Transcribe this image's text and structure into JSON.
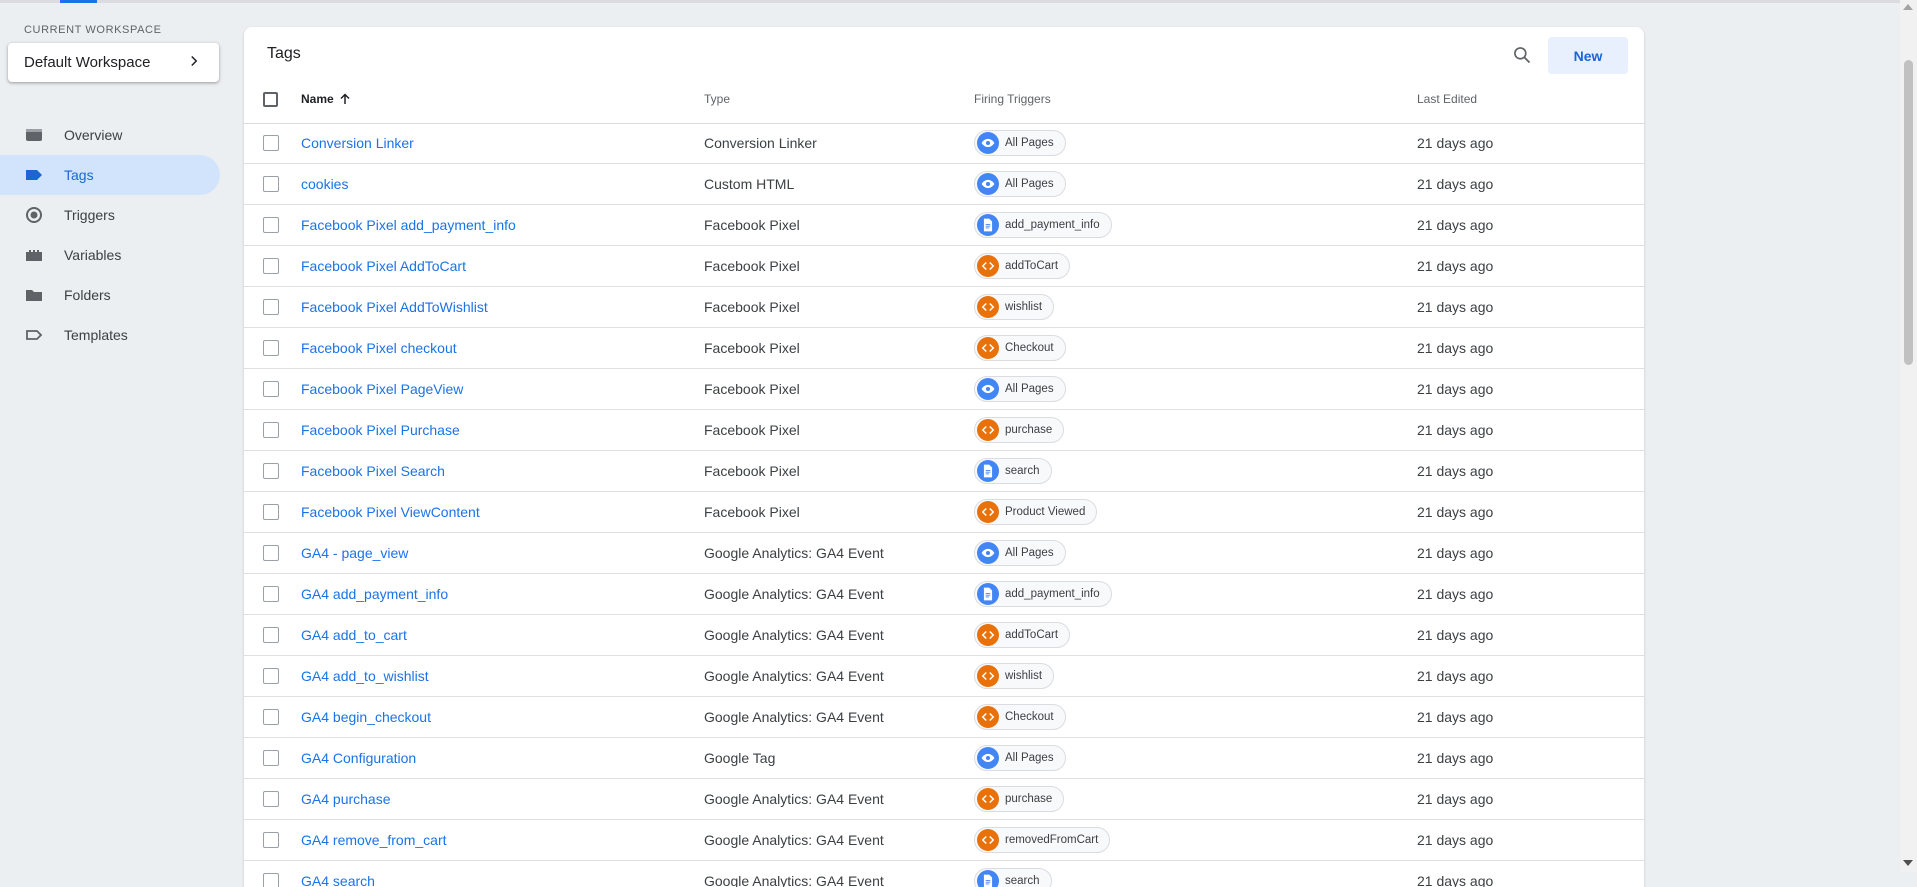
{
  "workspace": {
    "label": "CURRENT WORKSPACE",
    "name": "Default Workspace"
  },
  "nav": [
    {
      "label": "Overview",
      "icon": "overview-icon"
    },
    {
      "label": "Tags",
      "icon": "tag-icon",
      "active": true
    },
    {
      "label": "Triggers",
      "icon": "trigger-icon"
    },
    {
      "label": "Variables",
      "icon": "variables-icon"
    },
    {
      "label": "Folders",
      "icon": "folder-icon"
    },
    {
      "label": "Templates",
      "icon": "template-icon"
    }
  ],
  "card": {
    "title": "Tags",
    "new_label": "New"
  },
  "columns": {
    "name": "Name",
    "type": "Type",
    "triggers": "Firing Triggers",
    "edited": "Last Edited",
    "sort": "ascending"
  },
  "rows": [
    {
      "name": "Conversion Linker",
      "type": "Conversion Linker",
      "trigger": "All Pages",
      "trigger_kind": "pageview",
      "edited": "21 days ago"
    },
    {
      "name": "cookies",
      "type": "Custom HTML",
      "trigger": "All Pages",
      "trigger_kind": "pageview",
      "edited": "21 days ago"
    },
    {
      "name": "Facebook Pixel add_payment_info",
      "type": "Facebook Pixel",
      "trigger": "add_payment_info",
      "trigger_kind": "click",
      "edited": "21 days ago"
    },
    {
      "name": "Facebook Pixel AddToCart",
      "type": "Facebook Pixel",
      "trigger": "addToCart",
      "trigger_kind": "custom",
      "edited": "21 days ago"
    },
    {
      "name": "Facebook Pixel AddToWishlist",
      "type": "Facebook Pixel",
      "trigger": "wishlist",
      "trigger_kind": "custom",
      "edited": "21 days ago"
    },
    {
      "name": "Facebook Pixel checkout",
      "type": "Facebook Pixel",
      "trigger": "Checkout",
      "trigger_kind": "custom",
      "edited": "21 days ago"
    },
    {
      "name": "Facebook Pixel PageView",
      "type": "Facebook Pixel",
      "trigger": "All Pages",
      "trigger_kind": "pageview",
      "edited": "21 days ago"
    },
    {
      "name": "Facebook Pixel Purchase",
      "type": "Facebook Pixel",
      "trigger": "purchase",
      "trigger_kind": "custom",
      "edited": "21 days ago"
    },
    {
      "name": "Facebook Pixel Search",
      "type": "Facebook Pixel",
      "trigger": "search",
      "trigger_kind": "click",
      "edited": "21 days ago"
    },
    {
      "name": "Facebook Pixel ViewContent",
      "type": "Facebook Pixel",
      "trigger": "Product Viewed",
      "trigger_kind": "custom",
      "edited": "21 days ago"
    },
    {
      "name": "GA4 - page_view",
      "type": "Google Analytics: GA4 Event",
      "trigger": "All Pages",
      "trigger_kind": "pageview",
      "edited": "21 days ago"
    },
    {
      "name": "GA4 add_payment_info",
      "type": "Google Analytics: GA4 Event",
      "trigger": "add_payment_info",
      "trigger_kind": "click",
      "edited": "21 days ago"
    },
    {
      "name": "GA4 add_to_cart",
      "type": "Google Analytics: GA4 Event",
      "trigger": "addToCart",
      "trigger_kind": "custom",
      "edited": "21 days ago"
    },
    {
      "name": "GA4 add_to_wishlist",
      "type": "Google Analytics: GA4 Event",
      "trigger": "wishlist",
      "trigger_kind": "custom",
      "edited": "21 days ago"
    },
    {
      "name": "GA4 begin_checkout",
      "type": "Google Analytics: GA4 Event",
      "trigger": "Checkout",
      "trigger_kind": "custom",
      "edited": "21 days ago"
    },
    {
      "name": "GA4 Configuration",
      "type": "Google Tag",
      "trigger": "All Pages",
      "trigger_kind": "pageview",
      "edited": "21 days ago"
    },
    {
      "name": "GA4 purchase",
      "type": "Google Analytics: GA4 Event",
      "trigger": "purchase",
      "trigger_kind": "custom",
      "edited": "21 days ago"
    },
    {
      "name": "GA4 remove_from_cart",
      "type": "Google Analytics: GA4 Event",
      "trigger": "removedFromCart",
      "trigger_kind": "custom",
      "edited": "21 days ago"
    },
    {
      "name": "GA4 search",
      "type": "Google Analytics: GA4 Event",
      "trigger": "search",
      "trigger_kind": "click",
      "edited": "21 days ago"
    }
  ],
  "colors": {
    "accent": "#1a73e8",
    "active_nav_bg": "#d2e3fc",
    "pageview_icon": "#4285f4",
    "custom_event_icon": "#e8710a"
  }
}
